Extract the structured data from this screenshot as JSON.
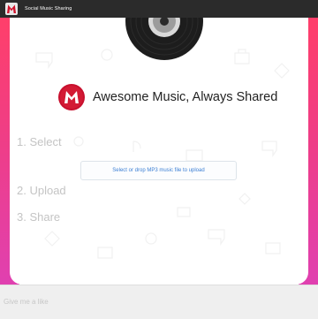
{
  "window": {
    "title": "Social Music Sharing"
  },
  "brand": {
    "tagline": "Awesome Music, Always Shared"
  },
  "steps": [
    {
      "label": "1. Select"
    },
    {
      "label": "2. Upload"
    },
    {
      "label": "3. Share"
    }
  ],
  "upload": {
    "label": "Select or drop MP3 music file to upload"
  },
  "footer": {
    "placeholder": "Give me a like"
  },
  "colors": {
    "accent_pink": "#ef3e86",
    "logo_red": "#c8102e",
    "link_blue": "#3b7fd4",
    "titlebar": "#2b2b2b"
  }
}
